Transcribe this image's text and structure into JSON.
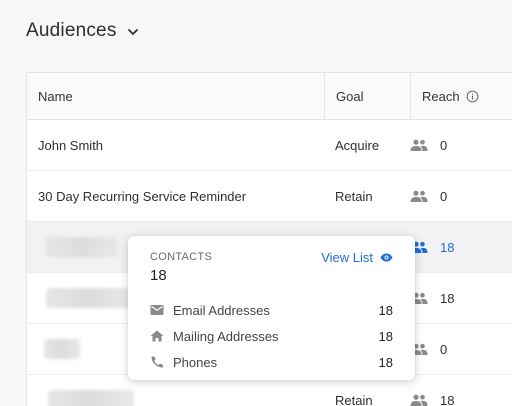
{
  "header": {
    "title": "Audiences"
  },
  "table": {
    "columns": {
      "name": "Name",
      "goal": "Goal",
      "reach": "Reach"
    },
    "rows": [
      {
        "name": "John Smith",
        "goal": "Acquire",
        "reach": "0"
      },
      {
        "name": "30 Day Recurring Service Reminder",
        "goal": "Retain",
        "reach": "0"
      },
      {
        "name": "",
        "goal": "",
        "reach": "18"
      },
      {
        "name": "",
        "goal": "",
        "reach": "18"
      },
      {
        "name": "",
        "goal": "",
        "reach": "0"
      },
      {
        "name": "",
        "goal": "Retain",
        "reach": "18"
      }
    ]
  },
  "popover": {
    "label": "CONTACTS",
    "total": "18",
    "view_list": "View List",
    "items": [
      {
        "icon": "mail-icon",
        "label": "Email Addresses",
        "count": "18"
      },
      {
        "icon": "home-icon",
        "label": "Mailing Addresses",
        "count": "18"
      },
      {
        "icon": "phone-icon",
        "label": "Phones",
        "count": "18"
      }
    ]
  },
  "colors": {
    "accent": "#1f6fd6",
    "icon_gray": "#8a8a8e"
  }
}
